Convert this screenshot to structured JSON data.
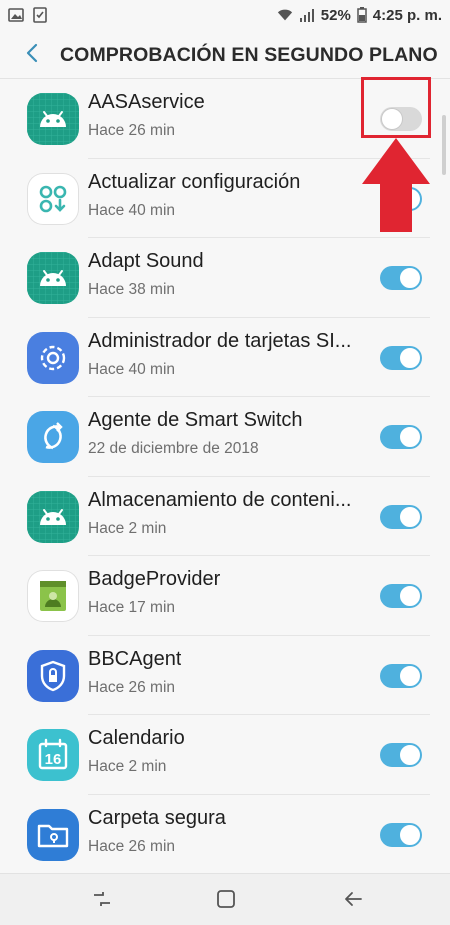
{
  "status_bar": {
    "battery_percent": "52%",
    "time": "4:25 p. m.",
    "left_icons": [
      "image-icon",
      "check-notification-icon"
    ],
    "right_icons": [
      "wifi-icon",
      "signal-icon",
      "battery-icon"
    ]
  },
  "header": {
    "title": "COMPROBACIÓN EN SEGUNDO PLANO"
  },
  "colors": {
    "accent": "#4fb1de",
    "annotation": "#e02531"
  },
  "apps": [
    {
      "name": "AASAservice",
      "sub": "Hace 26 min",
      "enabled": false,
      "icon": "android-icon"
    },
    {
      "name": "Actualizar configuración",
      "sub": "Hace 40 min",
      "enabled": true,
      "icon": "config-update-icon"
    },
    {
      "name": "Adapt Sound",
      "sub": "Hace 38 min",
      "enabled": true,
      "icon": "android-icon"
    },
    {
      "name": "Administrador de tarjetas SI...",
      "sub": "Hace 40 min",
      "enabled": true,
      "icon": "gear-icon"
    },
    {
      "name": "Agente de Smart Switch",
      "sub": "22 de diciembre de 2018",
      "enabled": true,
      "icon": "smart-switch-icon"
    },
    {
      "name": "Almacenamiento de conteni...",
      "sub": "Hace 2 min",
      "enabled": true,
      "icon": "android-icon"
    },
    {
      "name": "BadgeProvider",
      "sub": "Hace 17 min",
      "enabled": true,
      "icon": "badge-provider-icon"
    },
    {
      "name": "BBCAgent",
      "sub": "Hace 26 min",
      "enabled": true,
      "icon": "shield-icon"
    },
    {
      "name": "Calendario",
      "sub": "Hace 2 min",
      "enabled": true,
      "icon": "calendar-icon",
      "icon_text": "16"
    },
    {
      "name": "Carpeta segura",
      "sub": "Hace 26 min",
      "enabled": true,
      "icon": "secure-folder-icon"
    }
  ],
  "navbar": {
    "icons": [
      "recents-icon",
      "home-icon",
      "back-nav-icon"
    ]
  }
}
